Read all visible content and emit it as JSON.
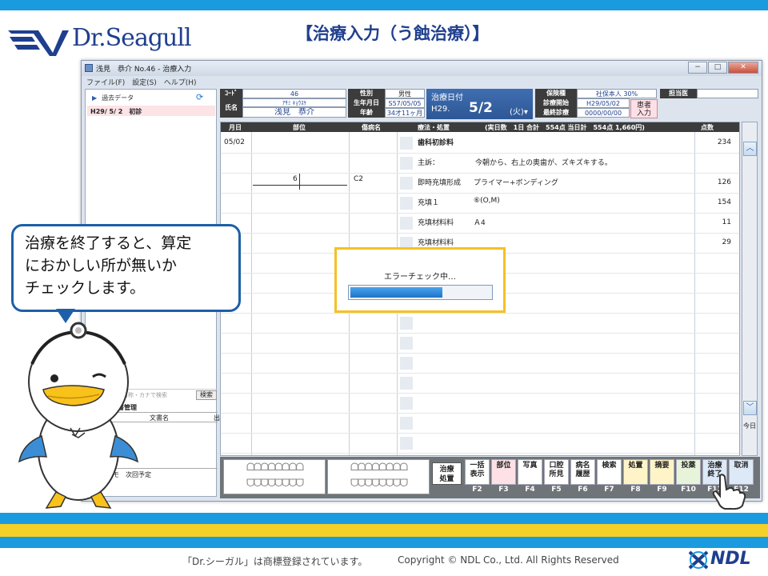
{
  "slide": {
    "logo_text": "Dr.Seagull",
    "title": "【治療入力（う蝕治療）】",
    "footer_trademark": "「Dr.シーガル」は商標登録されています。",
    "footer_copyright": "Copyright © NDL Co., Ltd. All Rights Reserved",
    "ndl_logo": "NDL",
    "colors": {
      "accent_blue": "#1a9be0",
      "accent_yellow": "#f5d028",
      "navy": "#1f3f8e"
    }
  },
  "window": {
    "title": "浅見　恭介 No.46 - 治療入力",
    "menus": [
      "ファイル(F)",
      "設定(S)",
      "ヘルプ(H)"
    ],
    "buttons": {
      "minimize": "−",
      "maximize": "□",
      "close": "✕"
    }
  },
  "left_panel": {
    "past_data_label": "過去データ",
    "past_items": [
      {
        "date": "H29/ 5/ 2",
        "label": "初診"
      }
    ],
    "search_placeholder": "コードまたは名称・カナで検索",
    "search_button": "検索",
    "doc_mgmt_label": "書管理",
    "doc_col_name": "文書名",
    "doc_col_out": "出",
    "tabs": [
      "メモ",
      "次回予定"
    ]
  },
  "patient": {
    "code_label": "ｺｰﾄﾞ",
    "code": "46",
    "name_label": "氏名",
    "kana": "ｱｻﾐ ｷｮｳｽｹ",
    "name": "浅見　恭介",
    "sex_label": "性別",
    "sex": "男性",
    "dob_label": "生年月日",
    "dob": "S57/05/05",
    "age_label": "年齢",
    "age": "34才11ヶ月",
    "treat_date_label": "治療日付",
    "era": "H29.",
    "treat_date": "5/2",
    "weekday": "(火)",
    "dropdown_icon": "▾",
    "insurance_label": "保険種",
    "insurance": "社保本人 30%",
    "start_label": "診療開始",
    "start_date": "H29/05/02",
    "last_label": "最終診療",
    "last_date": "0000/00/00",
    "doctor_label": "担当医",
    "doctor": "",
    "patient_info_button": "患者\n入力"
  },
  "grid": {
    "headers": {
      "date": "月日",
      "site": "部位",
      "disease": "傷病名",
      "treatment": "療法・処置",
      "summary": "(実日数　1日 合計　554点 当日計　554点 1,660円)",
      "points": "点数"
    },
    "date": "05/02",
    "tooth": "6",
    "disease": "C2",
    "rows": [
      {
        "name": "歯科初診料",
        "detail": "",
        "points": "234"
      },
      {
        "name": "主訴：",
        "detail": "今朝から、右上の奥歯が、ズキズキする。",
        "points": ""
      },
      {
        "name": "即時充填形成",
        "detail": "プライマー+ボンディング",
        "points": "126"
      },
      {
        "name": "充填１",
        "detail": "⑥(O,M)",
        "points": "154"
      },
      {
        "name": "充填材料料",
        "detail": "Ａ4",
        "points": "11"
      },
      {
        "name": "充填材料料",
        "detail": "",
        "points": "29"
      }
    ],
    "scroll_up": "︿",
    "scroll_down": "﹀",
    "today_label": "今日"
  },
  "toolbar": {
    "teeth_upper_left": "ᗝᗝᗝᗝᗝᗝᗝᗝ",
    "teeth_upper_right": "ᗝᗝᗝᗝᗝᗝᗝᗝ",
    "teeth_lower_left": "ᗜᗜᗜᗜᗜᗜᗜᗜ",
    "teeth_lower_right": "ᗜᗜᗜᗜᗜᗜᗜᗜ",
    "treatment_process": "治療\n処置",
    "buttons": [
      {
        "label": "一括\n表示",
        "key": "F2",
        "style": "white"
      },
      {
        "label": "部位",
        "key": "F3",
        "style": "pink"
      },
      {
        "label": "写真",
        "key": "F4",
        "style": "white"
      },
      {
        "label": "口腔\n所見",
        "key": "F5",
        "style": "white"
      },
      {
        "label": "病名\n履歴",
        "key": "F6",
        "style": "white"
      },
      {
        "label": "検索",
        "key": "F7",
        "style": "white"
      },
      {
        "label": "処置",
        "key": "F8",
        "style": "yellow"
      },
      {
        "label": "摘要",
        "key": "F9",
        "style": "yellow"
      },
      {
        "label": "投薬",
        "key": "F10",
        "style": "green"
      },
      {
        "label": "治療\n終了",
        "key": "F11",
        "style": "blue"
      },
      {
        "label": "取消",
        "key": "F12",
        "style": "blue"
      }
    ]
  },
  "dialog": {
    "message": "エラーチェック中…",
    "progress": 0.65
  },
  "bubble": {
    "lines": [
      "治療を終了すると、算定",
      "におかしい所が無いか",
      "チェックします。"
    ]
  }
}
